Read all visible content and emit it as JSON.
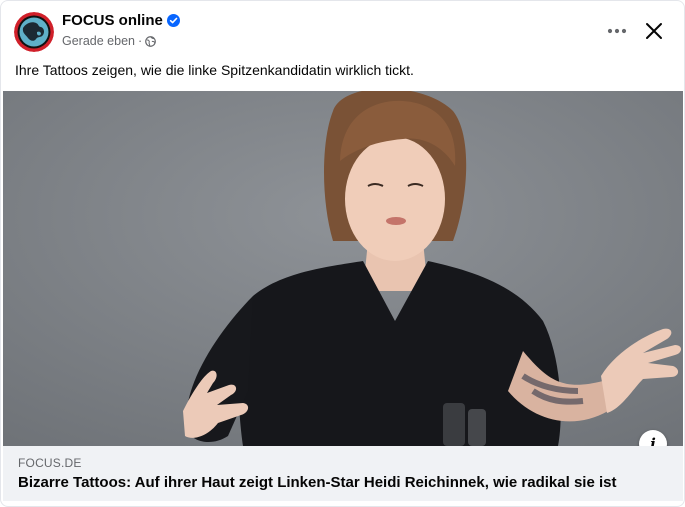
{
  "post": {
    "page_name": "FOCUS online",
    "verified_icon": "verified-badge-icon",
    "timestamp": "Gerade eben",
    "separator": "·",
    "audience_icon": "globe-icon",
    "caption": "Ihre Tattoos zeigen, wie die linke Spitzenkandidatin wirklich tickt.",
    "actions": {
      "more_icon": "more-options-icon",
      "close_icon": "close-icon"
    }
  },
  "link_preview": {
    "domain": "FOCUS.DE",
    "headline": "Bizarre Tattoos: Auf ihrer Haut zeigt Linken-Star Heidi Reichinnek, wie radikal sie ist",
    "info_label": "i"
  },
  "colors": {
    "verified_blue": "#0866ff",
    "secondary_text": "#65676b",
    "footer_bg": "#f0f2f5",
    "avatar_ring": "#d0202a"
  }
}
